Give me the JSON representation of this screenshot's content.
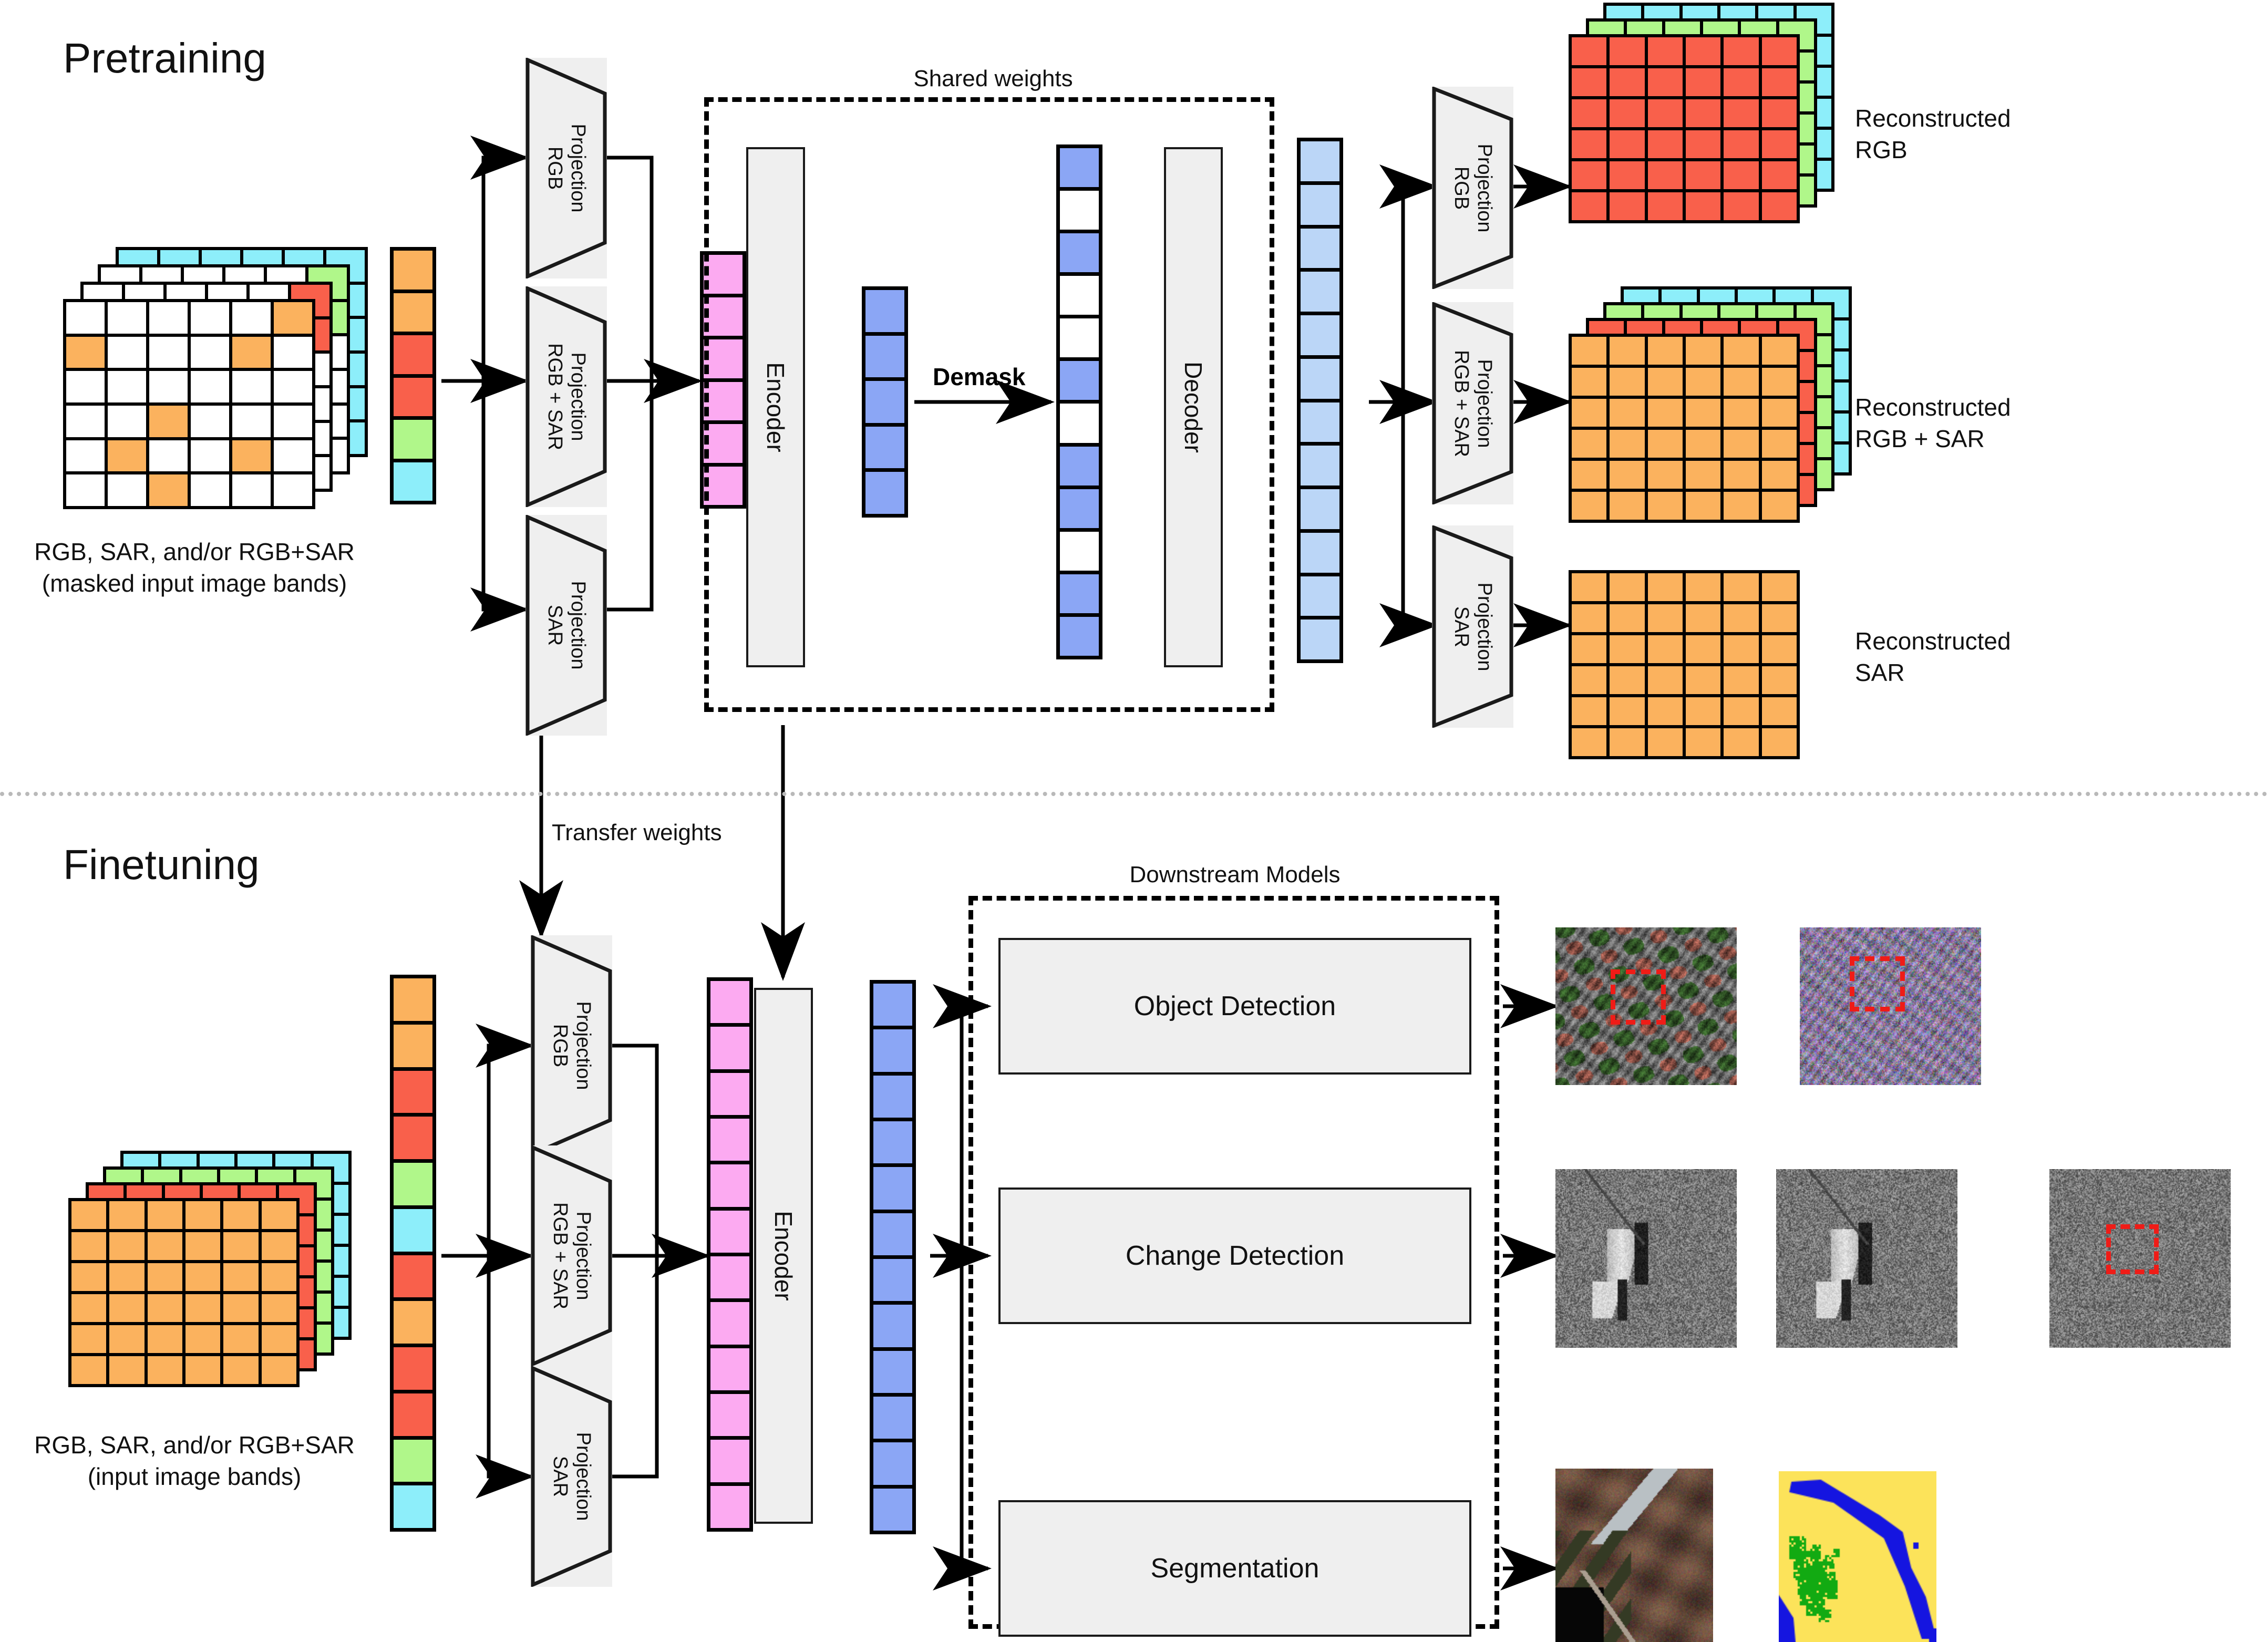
{
  "sections": {
    "pretraining": {
      "title": "Pretraining"
    },
    "finetuning": {
      "title": "Finetuning"
    }
  },
  "labels": {
    "shared_weights": "Shared weights",
    "downstream_models": "Downstream Models",
    "transfer_weights": "Transfer weights",
    "demask": "Demask",
    "encoder": "Encoder",
    "decoder": "Decoder",
    "encoder_ft": "Encoder"
  },
  "captions": {
    "pretrain_input_line1": "RGB, SAR, and/or RGB+SAR",
    "pretrain_input_line2": "(masked input image bands)",
    "finetune_input_line1": "RGB, SAR, and/or RGB+SAR",
    "finetune_input_line2": "(input image bands)"
  },
  "projections": {
    "rgb": "Projection\nRGB",
    "rgb_sar": "Projection\nRGB + SAR",
    "sar": "Projection\nSAR",
    "rgb_line1": "Projection",
    "rgb_line2": "RGB",
    "rgbsar_line1": "Projection",
    "rgbsar_line2": "RGB + SAR",
    "sar_line1": "Projection",
    "sar_line2": "SAR"
  },
  "outputs": {
    "recon_rgb_line1": "Reconstructed",
    "recon_rgb_line2": "RGB",
    "recon_rgbsar_line1": "Reconstructed",
    "recon_rgbsar_line2": "RGB + SAR",
    "recon_sar_line1": "Reconstructed",
    "recon_sar_line2": "SAR"
  },
  "downstream_tasks": [
    {
      "name": "Object Detection"
    },
    {
      "name": "Change Detection"
    },
    {
      "name": "Segmentation"
    }
  ],
  "colors": {
    "orange": "#FBB25E",
    "red": "#F9604B",
    "green": "#B0F78A",
    "cyan": "#8DEEFA",
    "pink": "#FCAAF1",
    "blue_token": "#8BA6F5",
    "blue_light": "#BBD6F7",
    "white": "#FFFFFF",
    "gray_block": "#EFEFEF",
    "stroke": "#000000",
    "bbox_red": "#EF1C17",
    "seg_yellow": "#FCE35A",
    "seg_blue": "#1515E0",
    "seg_green": "#12AA12",
    "divider": "#B9B9B9"
  },
  "token_strips": {
    "pretrain_input": [
      "orange",
      "orange",
      "red",
      "red",
      "green",
      "cyan"
    ],
    "pretrain_pink": [
      "pink",
      "pink",
      "pink",
      "pink",
      "pink",
      "pink"
    ],
    "encoded_blue": [
      "blue_token",
      "blue_token",
      "blue_token",
      "blue_token",
      "blue_token"
    ],
    "demasked": [
      "blue_token",
      "white",
      "blue_token",
      "white",
      "white",
      "blue_token",
      "white",
      "blue_token",
      "blue_token",
      "white",
      "blue_token",
      "blue_token"
    ],
    "decoded_light": [
      "blue_light",
      "blue_light",
      "blue_light",
      "blue_light",
      "blue_light",
      "blue_light",
      "blue_light",
      "blue_light",
      "blue_light",
      "blue_light",
      "blue_light",
      "blue_light"
    ],
    "finetune_input": [
      "orange",
      "orange",
      "red",
      "red",
      "green",
      "cyan",
      "red",
      "orange",
      "red",
      "red",
      "green",
      "cyan"
    ],
    "finetune_pink": [
      "pink",
      "pink",
      "pink",
      "pink",
      "pink",
      "pink",
      "pink",
      "pink",
      "pink",
      "pink",
      "pink",
      "pink"
    ],
    "finetune_blue": [
      "blue_token",
      "blue_token",
      "blue_token",
      "blue_token",
      "blue_token",
      "blue_token",
      "blue_token",
      "blue_token",
      "blue_token",
      "blue_token",
      "blue_token",
      "blue_token"
    ]
  },
  "image_stacks": {
    "pretrain_masked": {
      "rows": 6,
      "cols": 6,
      "layers": [
        "cyan",
        "green",
        "red",
        "masked_white"
      ],
      "masked_cells": [
        [
          1,
          5
        ],
        [
          2,
          0
        ],
        [
          2,
          4
        ],
        [
          4,
          2
        ],
        [
          5,
          1
        ],
        [
          5,
          4
        ],
        [
          6,
          2
        ]
      ]
    },
    "finetune_input": {
      "rows": 6,
      "cols": 6,
      "layers": [
        "cyan",
        "green",
        "red",
        "orange"
      ]
    },
    "recon_rgb": {
      "rows": 6,
      "cols": 6,
      "layers": [
        "cyan",
        "green",
        "red"
      ]
    },
    "recon_rgbsar": {
      "rows": 6,
      "cols": 6,
      "layers": [
        "cyan",
        "green",
        "red",
        "orange"
      ]
    },
    "recon_sar": {
      "rows": 6,
      "cols": 6,
      "layers": [
        "orange"
      ]
    }
  }
}
